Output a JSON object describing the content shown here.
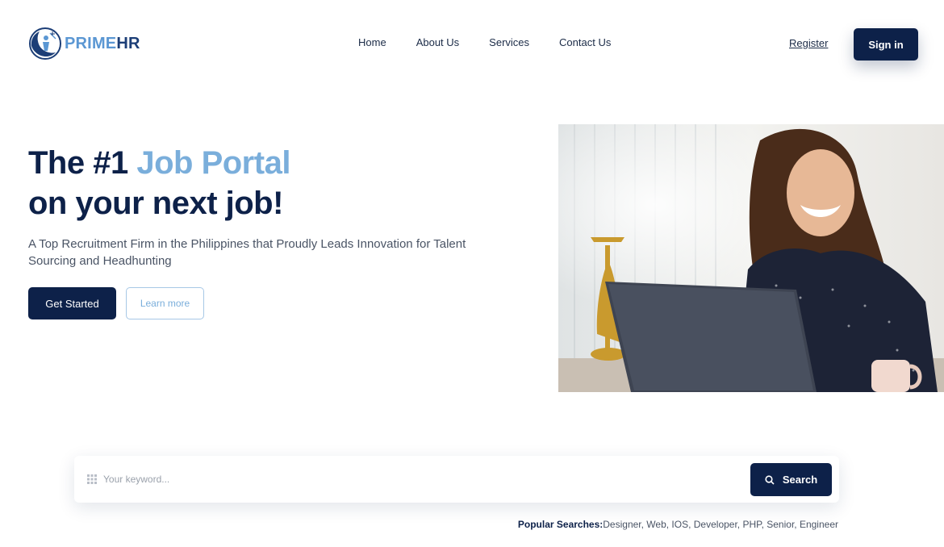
{
  "brand": {
    "prime": "PRIME",
    "hr": "HR"
  },
  "nav": {
    "items": [
      {
        "label": "Home"
      },
      {
        "label": "About Us"
      },
      {
        "label": "Services"
      },
      {
        "label": "Contact Us"
      }
    ],
    "register_label": "Register",
    "signin_label": "Sign in"
  },
  "hero": {
    "title_part1": "The #1 ",
    "title_accent": "Job Portal",
    "title_line2": "on your next job!",
    "subtitle": "A Top Recruitment Firm in the Philippines that Proudly Leads Innovation for Talent Sourcing and Headhunting",
    "get_started_label": "Get Started",
    "learn_more_label": "Learn more"
  },
  "search": {
    "placeholder": "Your keyword...",
    "button_label": "Search"
  },
  "popular": {
    "label": "Popular Searches:",
    "terms": "Designer, Web, IOS, Developer, PHP, Senior, Engineer"
  },
  "colors": {
    "navy": "#0d2149",
    "accent_blue": "#7aaedb",
    "logo_blue": "#5b97d3"
  },
  "icons": {
    "logo": "compass-globe-icon",
    "search": "magnifier-icon",
    "keyword": "grid-dots-icon"
  }
}
